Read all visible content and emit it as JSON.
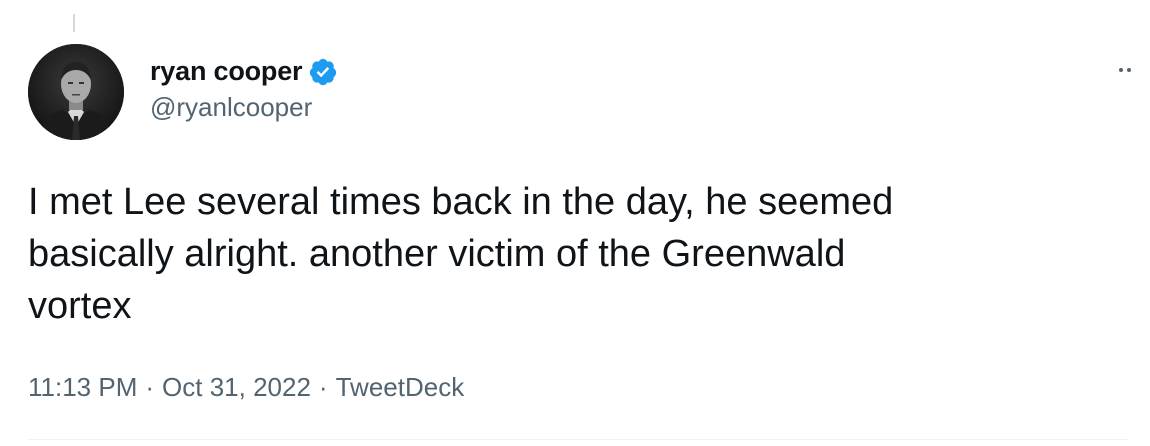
{
  "tweet": {
    "author": {
      "display_name": "ryan cooper",
      "handle": "@ryanlcooper",
      "verified": true
    },
    "text_lines": [
      "I met Lee several times back in the day, he seemed",
      "basically alright. another victim of the Greenwald",
      "vortex"
    ],
    "time": "11:13 PM",
    "separator": "·",
    "date": "Oct 31, 2022",
    "source": "TweetDeck"
  },
  "icons": {
    "verified": "verified-badge-icon",
    "more": "more-options-icon"
  },
  "colors": {
    "text": "#0f1419",
    "secondary": "#536471",
    "verified": "#1d9bf0"
  }
}
